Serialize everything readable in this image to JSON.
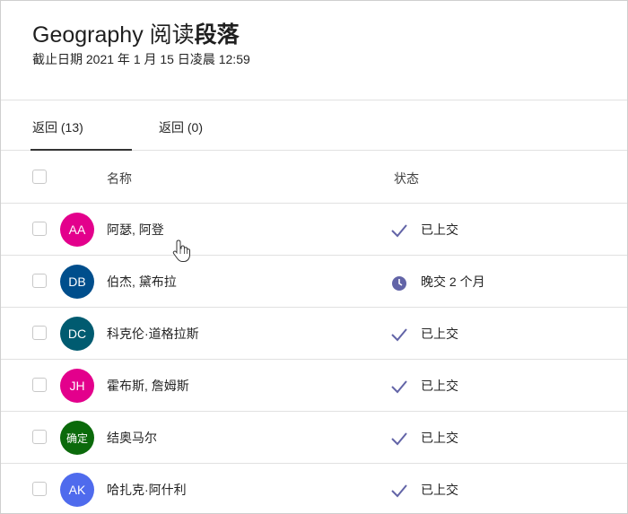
{
  "header": {
    "title_latin": "Geography",
    "title_cjk_light": "阅读",
    "title_cjk_bold": "段落",
    "due_date": "截止日期 2021 年 1 月 15 日凌晨 12:59"
  },
  "tabs": [
    {
      "label": "返回 (13)",
      "selected": true
    },
    {
      "label": "返回 (0)",
      "selected": false
    }
  ],
  "columns": {
    "name": "名称",
    "status": "状态"
  },
  "colors": {
    "status_icon": "#6264a7",
    "avatar_AA": "#e3008c",
    "avatar_DB": "#004e8c",
    "avatar_DC": "#005b70",
    "avatar_JH": "#e3008c",
    "avatar_confirm": "#0b6a0b",
    "avatar_AK": "#4f6bed"
  },
  "students": [
    {
      "initials": "AA",
      "name": "阿瑟, 阿登",
      "status": "已上交",
      "status_icon": "checkmark-icon"
    },
    {
      "initials": "DB",
      "name": "伯杰, 黛布拉",
      "status": "晚交 2 个月",
      "status_icon": "clock-icon"
    },
    {
      "initials": "DC",
      "name": "科克伦·道格拉斯",
      "status": "已上交",
      "status_icon": "checkmark-icon"
    },
    {
      "initials": "JH",
      "name": "霍布斯, 詹姆斯",
      "status": "已上交",
      "status_icon": "checkmark-icon"
    },
    {
      "initials": "确定",
      "name": "结奥马尔",
      "status": "已上交",
      "status_icon": "checkmark-icon"
    },
    {
      "initials": "AK",
      "name": "哈扎克·阿什利",
      "status": "已上交",
      "status_icon": "checkmark-icon"
    }
  ]
}
